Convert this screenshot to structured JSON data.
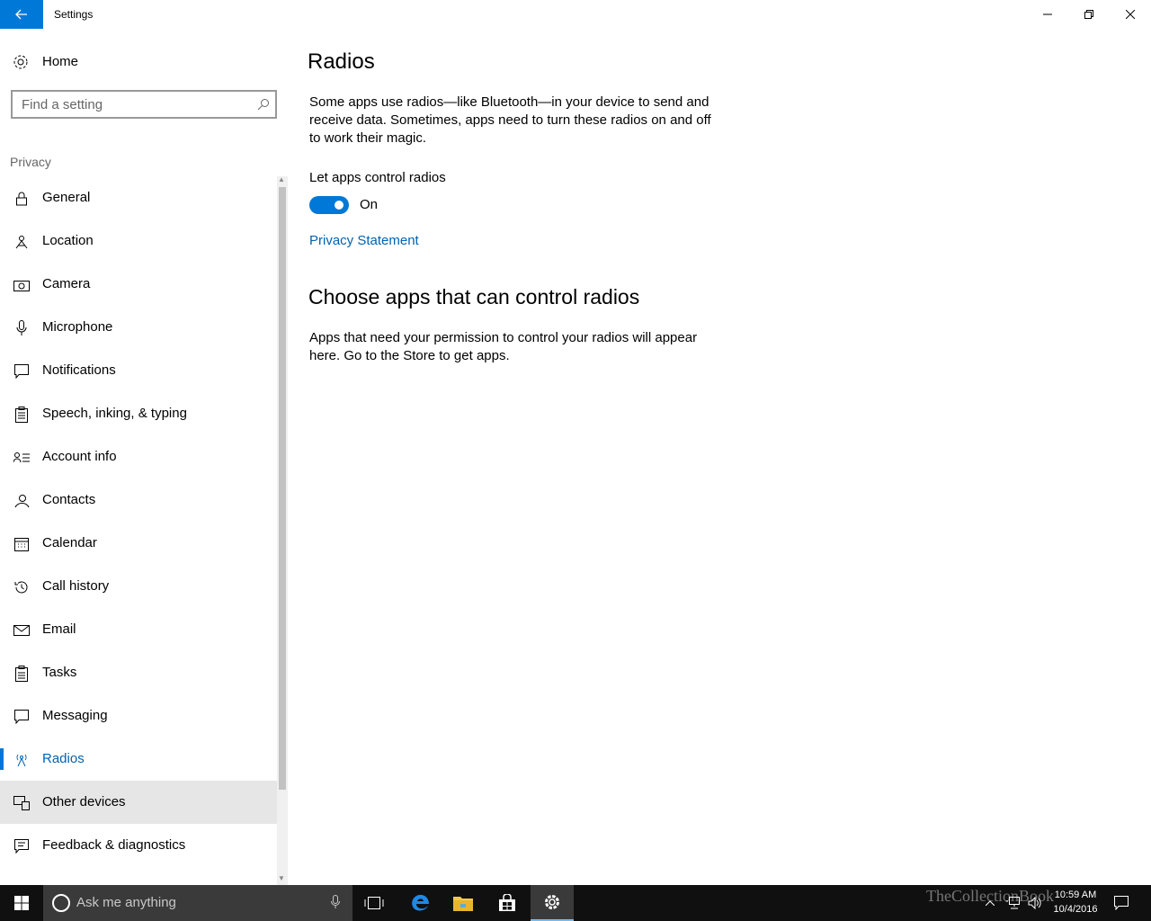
{
  "window": {
    "title": "Settings",
    "back_icon": "back-arrow-icon",
    "controls": [
      "minimize-icon",
      "restore-icon",
      "close-icon"
    ]
  },
  "sidebar": {
    "home_label": "Home",
    "search_placeholder": "Find a setting",
    "section_label": "Privacy",
    "items": [
      {
        "label": "General",
        "icon": "lock-icon"
      },
      {
        "label": "Location",
        "icon": "location-icon"
      },
      {
        "label": "Camera",
        "icon": "camera-icon"
      },
      {
        "label": "Microphone",
        "icon": "microphone-icon"
      },
      {
        "label": "Notifications",
        "icon": "notifications-icon"
      },
      {
        "label": "Speech, inking, & typing",
        "icon": "speech-icon"
      },
      {
        "label": "Account info",
        "icon": "account-info-icon"
      },
      {
        "label": "Contacts",
        "icon": "contacts-icon"
      },
      {
        "label": "Calendar",
        "icon": "calendar-icon"
      },
      {
        "label": "Call history",
        "icon": "call-history-icon"
      },
      {
        "label": "Email",
        "icon": "email-icon"
      },
      {
        "label": "Tasks",
        "icon": "tasks-icon"
      },
      {
        "label": "Messaging",
        "icon": "messaging-icon"
      },
      {
        "label": "Radios",
        "icon": "radios-icon",
        "selected": true
      },
      {
        "label": "Other devices",
        "icon": "other-devices-icon",
        "hovered": true
      },
      {
        "label": "Feedback & diagnostics",
        "icon": "feedback-icon"
      }
    ]
  },
  "main": {
    "title": "Radios",
    "description": "Some apps use radios—like Bluetooth—in your device to send and receive data. Sometimes, apps need to turn these radios on and off to work their magic.",
    "toggle_label": "Let apps control radios",
    "toggle_state": "On",
    "toggle_on": true,
    "privacy_link": "Privacy Statement",
    "section_title": "Choose apps that can control radios",
    "section_description": "Apps that need your permission to control your radios will appear here. Go to the Store to get apps."
  },
  "taskbar": {
    "search_placeholder": "Ask me anything",
    "time": "10:59 AM",
    "date": "10/4/2016",
    "watermark": "TheCollectionBook"
  },
  "colors": {
    "accent": "#0078d7",
    "link": "#0063b1",
    "taskbar": "#101010"
  }
}
